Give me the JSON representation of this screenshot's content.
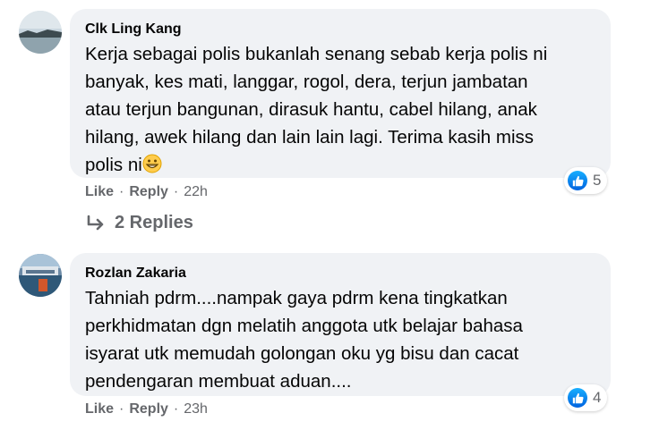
{
  "comments": [
    {
      "author": "Clk Ling Kang",
      "text_lines": [
        "Kerja sebagai polis bukanlah senang sebab kerja polis ni",
        "banyak, kes mati, langgar, rogol, dera, terjun jambatan",
        "atau terjun bangunan, dirasuk hantu, cabel hilang, anak",
        "hilang, awek hilang dan lain lain lagi. Terima kasih miss",
        "polis ni"
      ],
      "trailing_emoji": "grinning-face-emoji",
      "reaction_count": "5",
      "like_label": "Like",
      "reply_label": "Reply",
      "time": "22h",
      "replies_label": "2 Replies"
    },
    {
      "author": "Rozlan Zakaria",
      "text_lines": [
        "Tahniah pdrm....nampak gaya pdrm kena tingkatkan",
        "perkhidmatan dgn melatih anggota utk belajar bahasa",
        "isyarat utk memudah golongan oku yg bisu dan cacat",
        "pendengaran membuat aduan...."
      ],
      "reaction_count": "4",
      "like_label": "Like",
      "reply_label": "Reply",
      "time": "23h"
    }
  ],
  "separator": "·",
  "icons": {
    "reaction": "thumbs-up-icon",
    "replies": "reply-arrow-icon"
  },
  "colors": {
    "bubble": "#f0f2f5",
    "meta_text": "#65676b",
    "like_blue": "#0866ff"
  }
}
